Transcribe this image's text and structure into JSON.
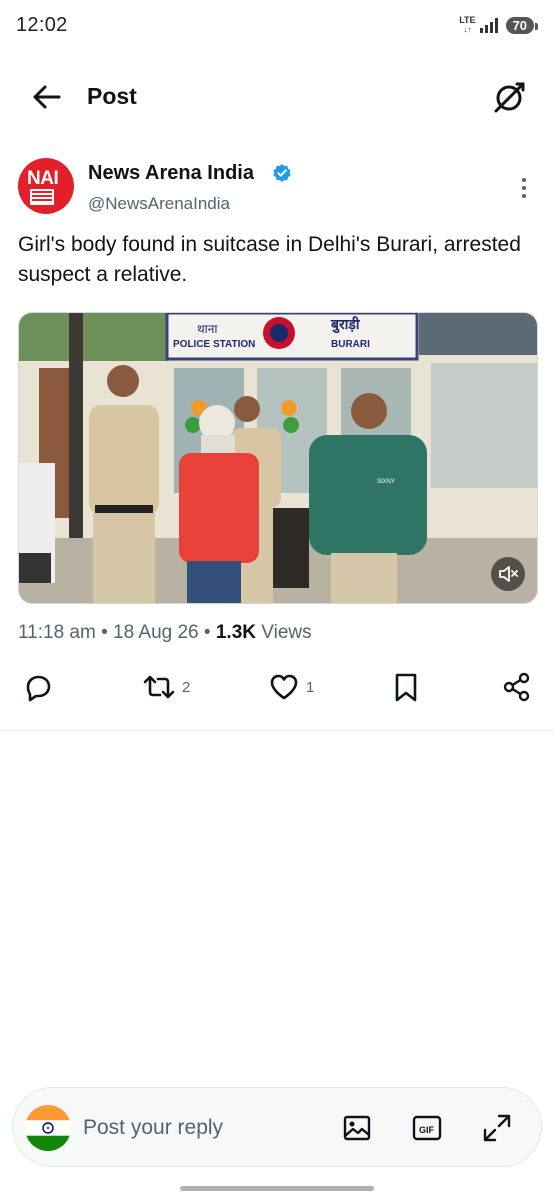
{
  "status": {
    "time": "12:02",
    "network": "LTE",
    "battery": "70"
  },
  "header": {
    "title": "Post"
  },
  "author": {
    "name": "News Arena India",
    "handle": "@NewsArenaIndia",
    "avatar_text": "NAI"
  },
  "post": {
    "text": "Girl's body found in suitcase in Delhi's Burari, arrested suspect a relative.",
    "media": {
      "sign_hindi_left": "थाना",
      "sign_left": "POLICE STATION",
      "sign_hindi_right": "बुराड़ी",
      "sign_right": "BURARI",
      "shirt_brand": "SIXNY"
    },
    "time": "11:18 am",
    "date": "18 Aug 26",
    "views_count": "1.3K",
    "views_label": "Views"
  },
  "actions": {
    "retweets": "2",
    "likes": "1"
  },
  "composer": {
    "placeholder": "Post your reply"
  },
  "colors": {
    "accent": "#1d9bf0",
    "brand": "#e2202a",
    "muted": "#536471"
  }
}
